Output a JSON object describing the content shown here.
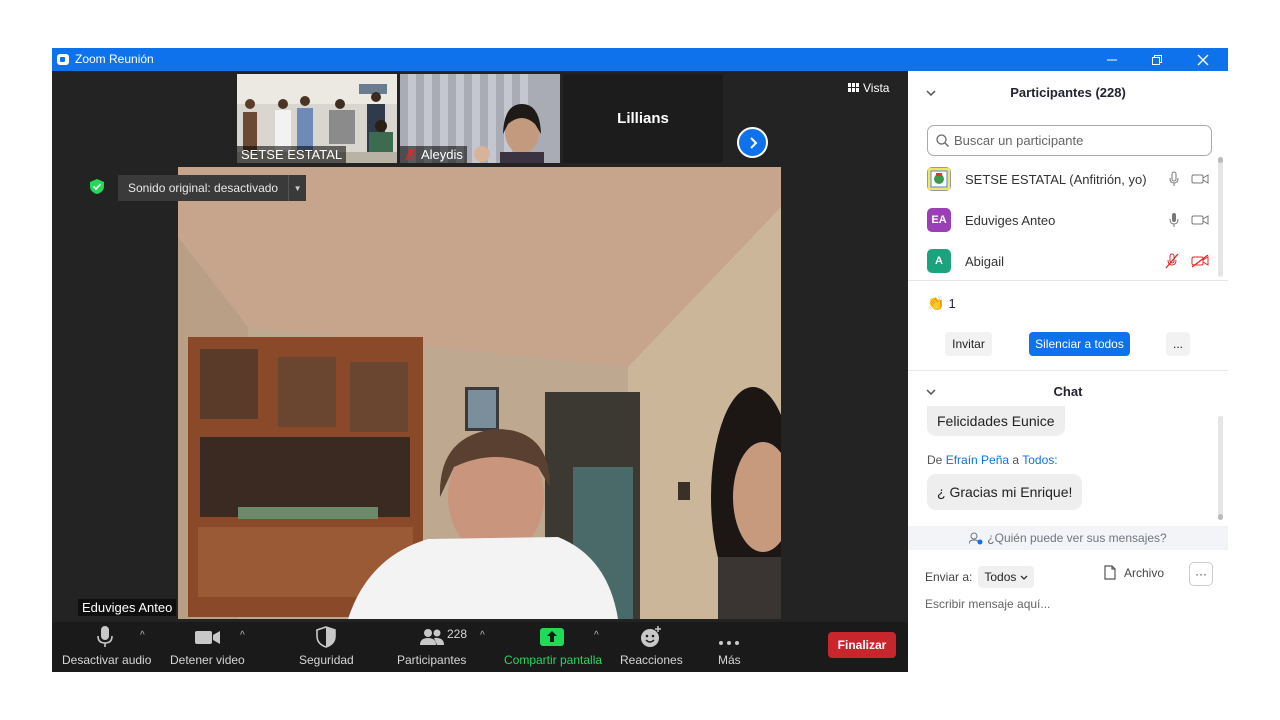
{
  "window": {
    "title": "Zoom Reunión"
  },
  "video": {
    "thumbnails": [
      {
        "name": "SETSE ESTATAL",
        "muted": false
      },
      {
        "name": "Aleydis",
        "muted": true
      },
      {
        "name": "Lillians",
        "muted": false
      }
    ],
    "view_label": "Vista",
    "original_sound": "Sonido original: desactivado",
    "main_speaker": "Eduviges Anteo"
  },
  "toolbar": {
    "audio": "Desactivar audio",
    "video": "Detener video",
    "security": "Seguridad",
    "participants": "Participantes",
    "participants_count": "228",
    "share": "Compartir pantalla",
    "reactions": "Reacciones",
    "more": "Más",
    "end": "Finalizar"
  },
  "participants_panel": {
    "title": "Participantes (228)",
    "search_placeholder": "Buscar un participante",
    "list": [
      {
        "initials": "",
        "name": "SETSE ESTATAL (Anfitrión, yo)",
        "muted": false,
        "video_off": false
      },
      {
        "initials": "EA",
        "name": "Eduviges Anteo",
        "muted": false,
        "video_off": false
      },
      {
        "initials": "A",
        "name": "Abigail",
        "muted": true,
        "video_off": true
      }
    ],
    "reaction_count": "1",
    "invite": "Invitar",
    "mute_all": "Silenciar a todos",
    "more": "..."
  },
  "chat": {
    "title": "Chat",
    "prev_message": "Felicidades Eunice",
    "from_label": "De",
    "from_name": "Efraín Peña",
    "to_word": "a",
    "to_name": "Todos:",
    "message": "¿ Gracias mi Enrique!",
    "who_sees": "¿Quién puede ver sus mensajes?",
    "send_to_label": "Enviar a:",
    "send_to_value": "Todos",
    "file": "Archivo",
    "more": "···",
    "input_placeholder": "Escribir mensaje aquí..."
  },
  "colors": {
    "zoom_blue": "#0e72ed",
    "share_green": "#23d959",
    "end_red": "#c8262d",
    "avatar_purple": "#9b3fb9",
    "avatar_teal": "#1aa37d"
  }
}
